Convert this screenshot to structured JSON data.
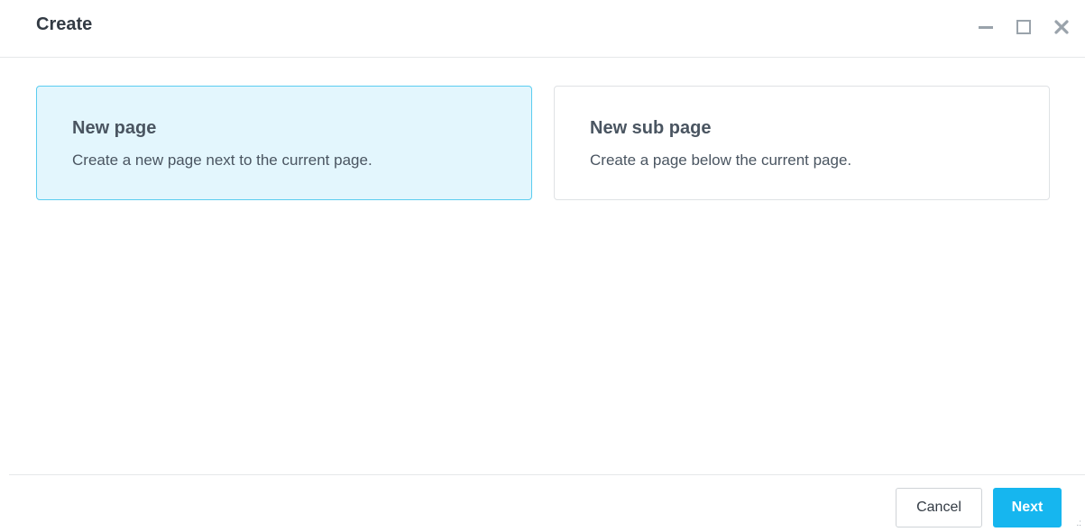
{
  "dialog": {
    "title": "Create",
    "controls": {
      "minimize": "minimize-icon",
      "maximize": "maximize-icon",
      "close": "close-icon"
    }
  },
  "options": [
    {
      "title": "New page",
      "description": "Create a new page next to the current page.",
      "selected": true
    },
    {
      "title": "New sub page",
      "description": "Create a page below the current page.",
      "selected": false
    }
  ],
  "footer": {
    "cancel_label": "Cancel",
    "next_label": "Next"
  },
  "colors": {
    "accent": "#16b6ef",
    "selected_bg": "#e3f6fd",
    "selected_border": "#5bcdf0"
  }
}
